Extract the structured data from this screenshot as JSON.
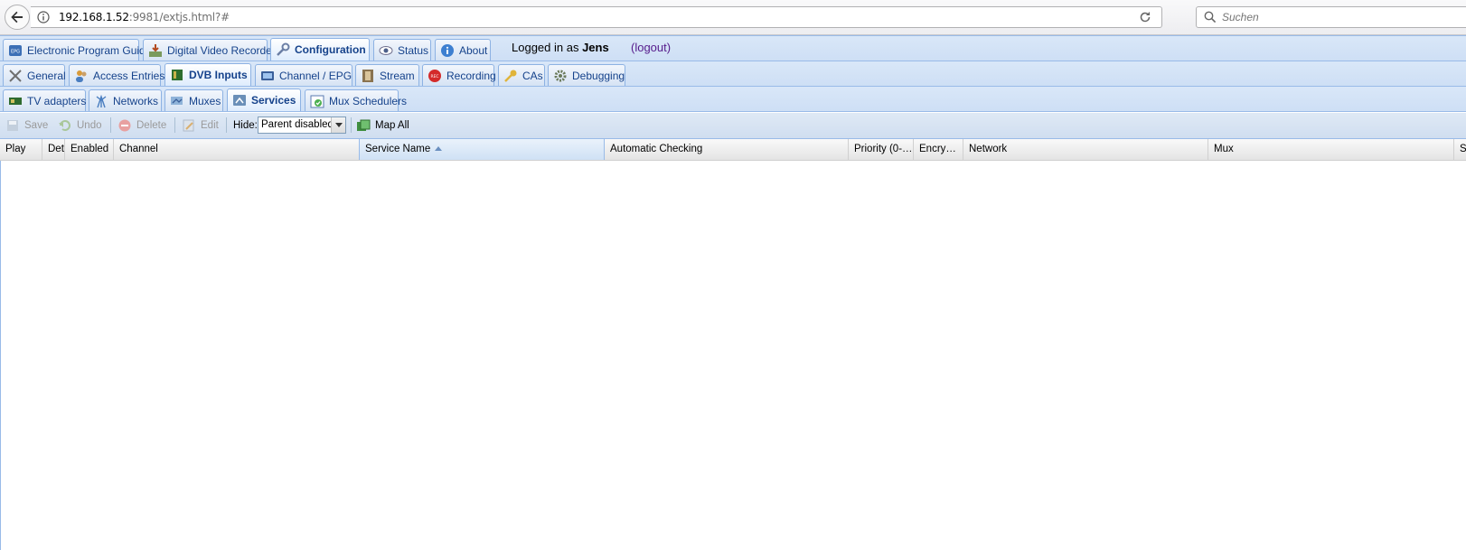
{
  "browser": {
    "url_host": "192.168.1.52",
    "url_rest": ":9981/extjs.html?#",
    "search_placeholder": "Suchen"
  },
  "main_tabs": [
    {
      "label": "Electronic Program Guide",
      "icon": "epg-icon"
    },
    {
      "label": "Digital Video Recorder",
      "icon": "dvr-icon"
    },
    {
      "label": "Configuration",
      "icon": "wrench-icon",
      "active": true
    },
    {
      "label": "Status",
      "icon": "eye-icon"
    },
    {
      "label": "About",
      "icon": "info-icon"
    }
  ],
  "login": {
    "prefix": "Logged in as",
    "user": "Jens",
    "logout": "(logout)"
  },
  "config_tabs": [
    {
      "label": "General",
      "icon": "tools-icon"
    },
    {
      "label": "Access Entries",
      "icon": "users-icon"
    },
    {
      "label": "DVB Inputs",
      "icon": "card-icon",
      "active": true
    },
    {
      "label": "Channel / EPG",
      "icon": "tv-icon"
    },
    {
      "label": "Stream",
      "icon": "film-icon"
    },
    {
      "label": "Recording",
      "icon": "rec-icon"
    },
    {
      "label": "CAs",
      "icon": "key-icon"
    },
    {
      "label": "Debugging",
      "icon": "gear-icon"
    }
  ],
  "dvb_tabs": [
    {
      "label": "TV adapters",
      "icon": "adapter-icon"
    },
    {
      "label": "Networks",
      "icon": "antenna-icon"
    },
    {
      "label": "Muxes",
      "icon": "satellite-icon"
    },
    {
      "label": "Services",
      "icon": "services-icon",
      "active": true
    },
    {
      "label": "Mux Schedulers",
      "icon": "scheduler-icon"
    }
  ],
  "toolbar": {
    "save": "Save",
    "undo": "Undo",
    "delete": "Delete",
    "edit": "Edit",
    "hide_label": "Hide:",
    "hide_value": "Parent disabled",
    "map_all": "Map All"
  },
  "grid": {
    "columns": [
      "Play",
      "Deta",
      "Enabled",
      "Channel",
      "Service Name",
      "Automatic Checking",
      "Priority (0-…",
      "Encry…",
      "Network",
      "Mux",
      "Se"
    ],
    "sorted_column": "Service Name",
    "sort_direction": "ascending",
    "rows": []
  }
}
